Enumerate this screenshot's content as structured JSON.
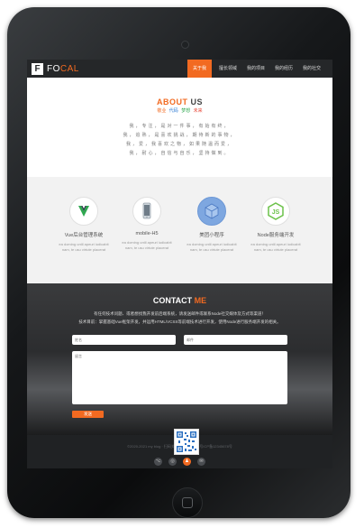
{
  "brand": {
    "prefix": "FO",
    "suffix": "CAL",
    "box_letter": "F"
  },
  "nav": {
    "items": [
      {
        "label": "关于我",
        "active": true
      },
      {
        "label": "擅长领域"
      },
      {
        "label": "我的项目"
      },
      {
        "label": "我的经历"
      },
      {
        "label": "我的社交"
      }
    ]
  },
  "about": {
    "title_a": "ABOUT",
    "title_b": "US",
    "tags": [
      {
        "text": "敬业",
        "color": "#f26a21"
      },
      {
        "text": "代码",
        "color": "#2e7bd4"
      },
      {
        "text": "梦想",
        "color": "#2fa84f"
      },
      {
        "text": "未来",
        "color": "#e84c3d"
      }
    ],
    "lines": [
      "我，专注，是对一件事，有始有终，",
      "我，追熟，是喜欢挑战，期待新的事物，",
      "我，爱，我喜欢之物，如果随温而爱，",
      "我，耐心，自信与自乐，坚持做到。"
    ]
  },
  "services": [
    {
      "title": "Vue后台管理系统",
      "desc": "ea doming until apeuri iudicabit nam, te usu virtute placerat",
      "icon": "vue-admin-icon"
    },
    {
      "title": "mobile-H5",
      "desc": "ea doming until apeuri iudicabit nam, te usu virtute placerat",
      "icon": "mobile-phone-icon"
    },
    {
      "title": "美团小程序",
      "desc": "ea doming until apeuri iudicabit nam, te usu virtute placerat",
      "icon": "mini-program-cube-icon"
    },
    {
      "title": "Node服务端开发",
      "desc": "ea doming until apeuri iudicabit nam, te usu virtute placerat",
      "icon": "nodejs-icon"
    }
  ],
  "contact": {
    "title_a": "CONTACT",
    "title_b": "ME",
    "line1": "有任何技术问题、或者想找我开发前后端系统，请发送邮件或联系Node社交媒体及方式等渠道！",
    "line2": "技术目前：掌握基础Vue框架开发，并运用HTML/VCSS等前端技术进行开发，使用Node进行服务端开发的相关。",
    "name_placeholder": "姓名",
    "email_placeholder": "邮件",
    "message_placeholder": "留言",
    "send_label": "发送"
  },
  "footer": {
    "text": "©2020-2021 my blog · 扫码关注我 · 网站备案号ICP备12345678号"
  },
  "social": [
    {
      "icon": "github-icon",
      "glyph": "⌥"
    },
    {
      "icon": "weibo-icon",
      "glyph": "◎"
    },
    {
      "icon": "qq-icon",
      "glyph": "♟",
      "active": true
    },
    {
      "icon": "wechat-icon",
      "glyph": "✉"
    }
  ]
}
